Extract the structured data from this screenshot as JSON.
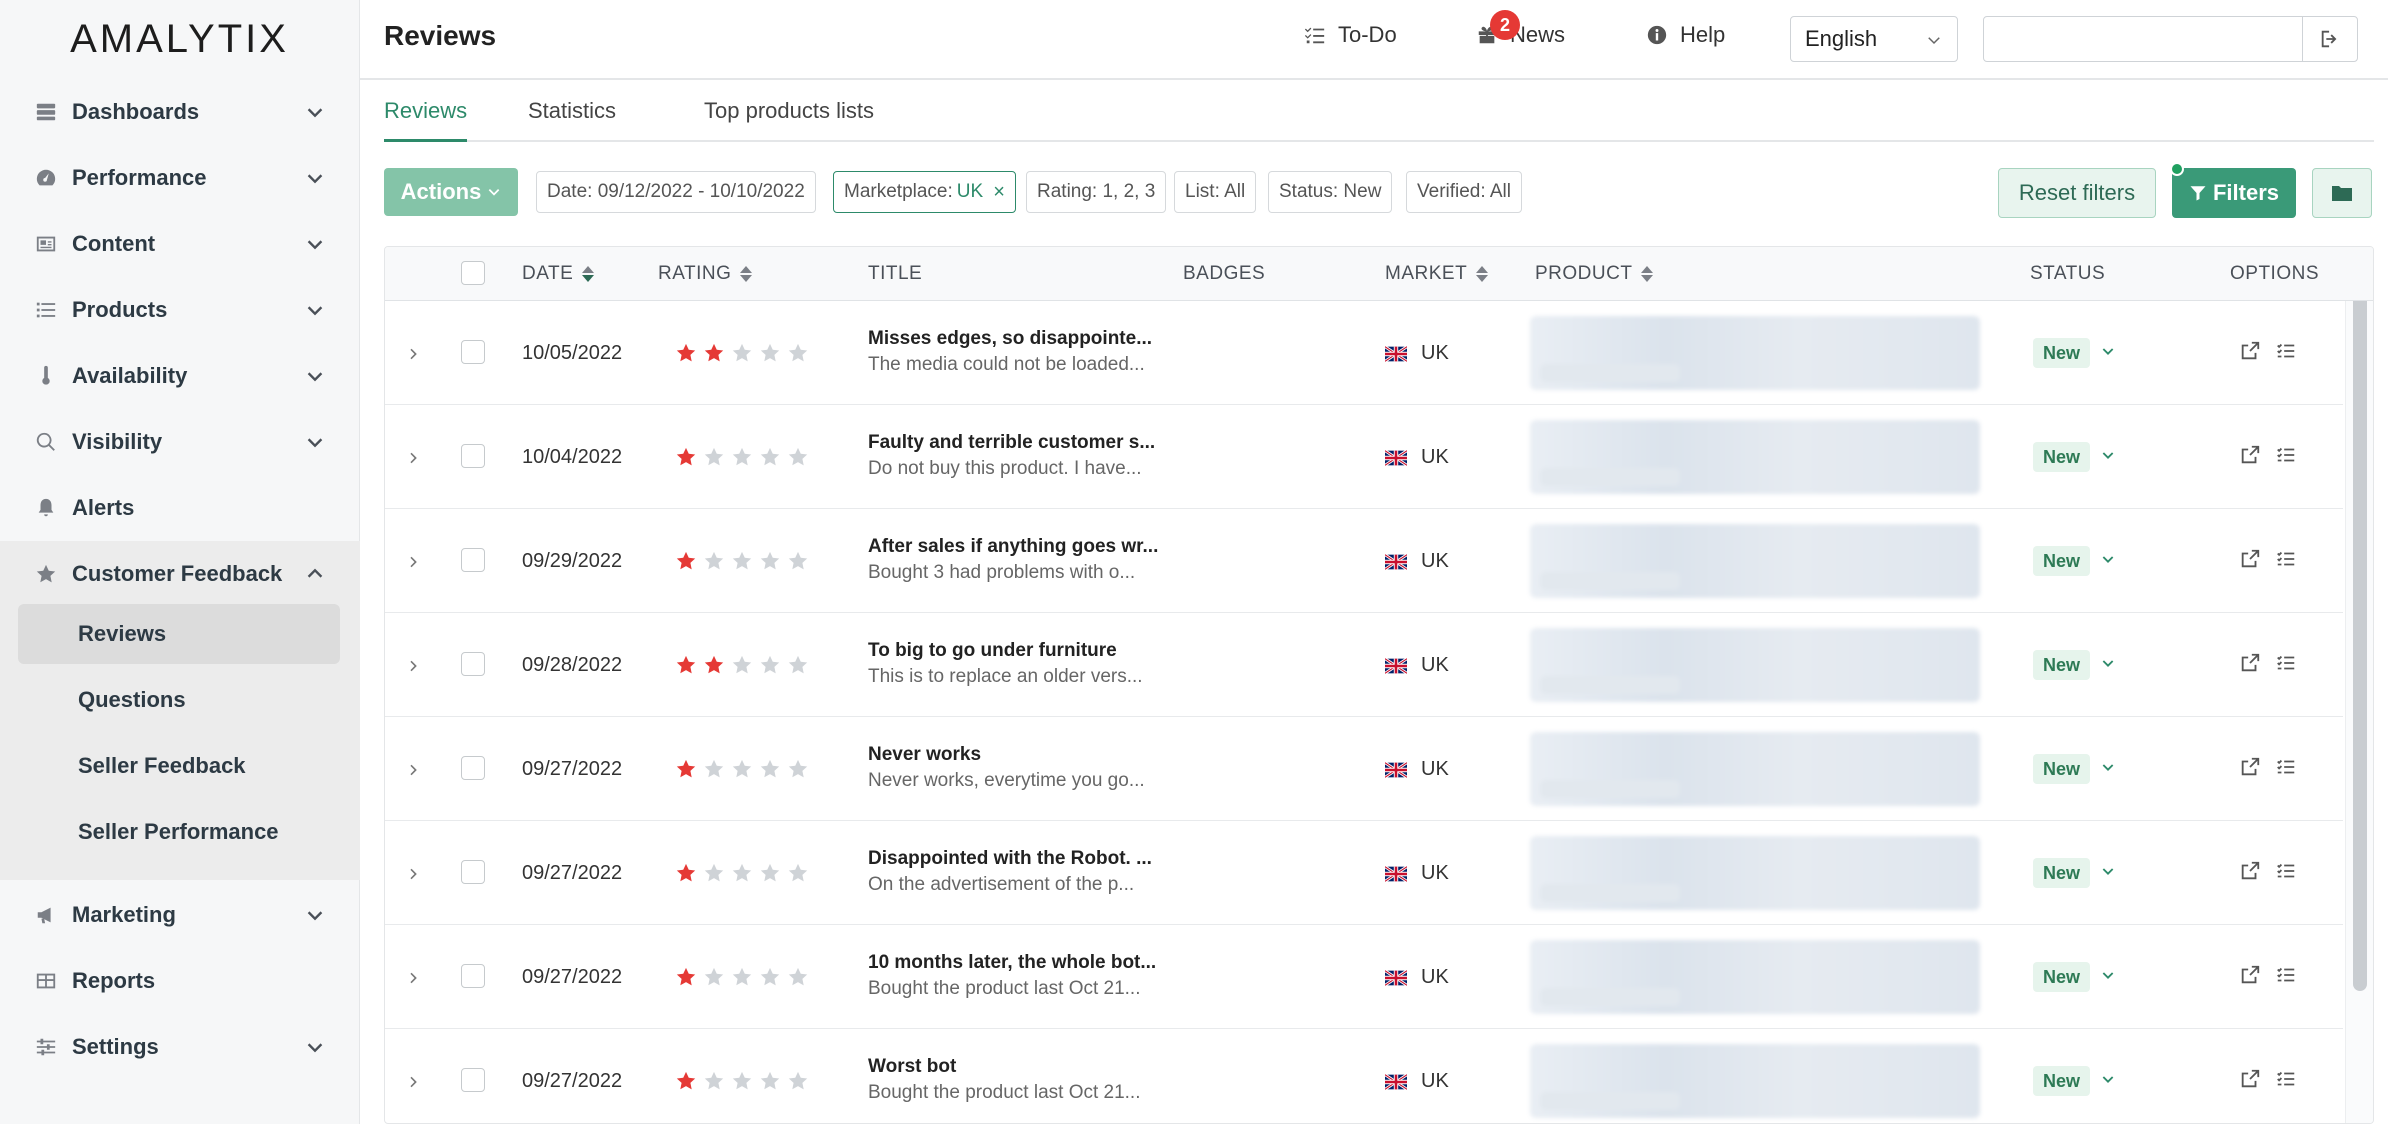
{
  "app": {
    "logo": "AMALYTIX",
    "page_title": "Reviews"
  },
  "topbar": {
    "todo": "To-Do",
    "news": "News",
    "news_count": "2",
    "help": "Help",
    "language": "English",
    "search_value": ""
  },
  "sidebar": {
    "items": [
      {
        "label": "Dashboards",
        "icon": "dashboard-icon"
      },
      {
        "label": "Performance",
        "icon": "gauge-icon"
      },
      {
        "label": "Content",
        "icon": "content-card-icon"
      },
      {
        "label": "Products",
        "icon": "list-icon"
      },
      {
        "label": "Availability",
        "icon": "thermometer-icon"
      },
      {
        "label": "Visibility",
        "icon": "search-icon"
      },
      {
        "label": "Alerts",
        "icon": "bell-icon"
      },
      {
        "label": "Customer Feedback",
        "icon": "star-icon"
      },
      {
        "label": "Marketing",
        "icon": "megaphone-icon"
      },
      {
        "label": "Reports",
        "icon": "table-icon"
      },
      {
        "label": "Settings",
        "icon": "sliders-icon"
      }
    ],
    "feedback_sub": [
      "Reviews",
      "Questions",
      "Seller Feedback",
      "Seller Performance"
    ]
  },
  "tabs": [
    "Reviews",
    "Statistics",
    "Top products lists"
  ],
  "toolbar": {
    "actions": "Actions",
    "reset_filters": "Reset filters",
    "filters": "Filters"
  },
  "chips": [
    {
      "label": "Date: 09/12/2022 - 10/10/2022",
      "value": "",
      "active": false
    },
    {
      "label": "Marketplace:",
      "value": "UK",
      "active": true
    },
    {
      "label": "Rating: 1, 2, 3",
      "value": "",
      "active": false
    },
    {
      "label": "List: All",
      "value": "",
      "active": false
    },
    {
      "label": "Status: New",
      "value": "",
      "active": false
    },
    {
      "label": "Verified: All",
      "value": "",
      "active": false
    }
  ],
  "table": {
    "headers": {
      "date": "DATE",
      "rating": "RATING",
      "title": "TITLE",
      "badges": "BADGES",
      "market": "MARKET",
      "product": "PRODUCT",
      "status": "STATUS",
      "options": "OPTIONS"
    },
    "rows": [
      {
        "date": "10/05/2022",
        "rating": 2,
        "title": "Misses edges, so disappointe...",
        "body": "The media could not be loaded...",
        "market": "UK",
        "status": "New"
      },
      {
        "date": "10/04/2022",
        "rating": 1,
        "title": "Faulty and terrible customer s...",
        "body": "Do not buy this product. I have...",
        "market": "UK",
        "status": "New"
      },
      {
        "date": "09/29/2022",
        "rating": 1,
        "title": "After sales if anything goes wr...",
        "body": "Bought 3 had problems with o...",
        "market": "UK",
        "status": "New"
      },
      {
        "date": "09/28/2022",
        "rating": 2,
        "title": "To big to go under furniture",
        "body": "This is to replace an older vers...",
        "market": "UK",
        "status": "New"
      },
      {
        "date": "09/27/2022",
        "rating": 1,
        "title": "Never works",
        "body": "Never works, everytime you go...",
        "market": "UK",
        "status": "New"
      },
      {
        "date": "09/27/2022",
        "rating": 1,
        "title": "Disappointed with the Robot. ...",
        "body": "On the advertisement of the p...",
        "market": "UK",
        "status": "New"
      },
      {
        "date": "09/27/2022",
        "rating": 1,
        "title": "10 months later, the whole bot...",
        "body": "Bought the product last Oct 21...",
        "market": "UK",
        "status": "New"
      },
      {
        "date": "09/27/2022",
        "rating": 1,
        "title": "Worst bot",
        "body": "Bought the product last Oct 21...",
        "market": "UK",
        "status": "New"
      }
    ]
  },
  "colors": {
    "accent": "#2d8a6a",
    "star_filled": "#e53935",
    "star_empty": "#cfd3d7"
  }
}
